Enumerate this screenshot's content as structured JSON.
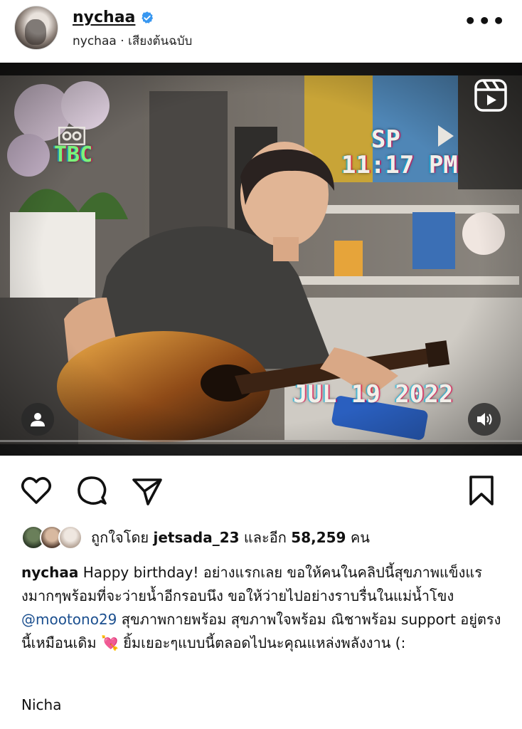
{
  "post": {
    "username": "nychaa",
    "subline": "nychaa · เสียงต้นฉบับ",
    "more_label": "•••"
  },
  "media": {
    "overlay": {
      "mode": "TBC",
      "speed": "SP",
      "time": "11:17 PM",
      "date": "JUL 19 2022"
    },
    "icons": [
      "reels-icon",
      "camera-icon",
      "play-icon",
      "person-icon",
      "speaker-icon"
    ]
  },
  "actions": [
    "heart-icon",
    "comment-icon",
    "share-icon",
    "bookmark-icon"
  ],
  "likes": {
    "prefix": "ถูกใจโดย",
    "user": "jetsada_23",
    "middle": "และอีก",
    "count": "58,259",
    "suffix": "คน"
  },
  "caption": {
    "user": "nychaa",
    "part1": " Happy birthday! อย่างแรกเลย ขอให้คนในคลิปนี้สุขภาพแข็งแรงมากๆพร้อมที่จะว่ายน้ำอีกรอบนึง ขอให้ว่ายไปอย่างราบรื่นในแม่น้ำโขง ",
    "mention": "@mootono29",
    "part2": " สุขภาพกายพร้อม สุขภาพใจพร้อม ณิชาพร้อม support อยู่ตรงนี้เหมือนเดิม ",
    "emoji": "💘",
    "part3": " ยิ้มเยอะๆแบบนี้ตลอดไปนะคุณแหล่งพลังงาน (:",
    "signature": "Nicha"
  },
  "colors": {
    "accent_verified": "#3897f0",
    "mention": "#1b4f8f",
    "vhs_green": "#7cf27a"
  }
}
